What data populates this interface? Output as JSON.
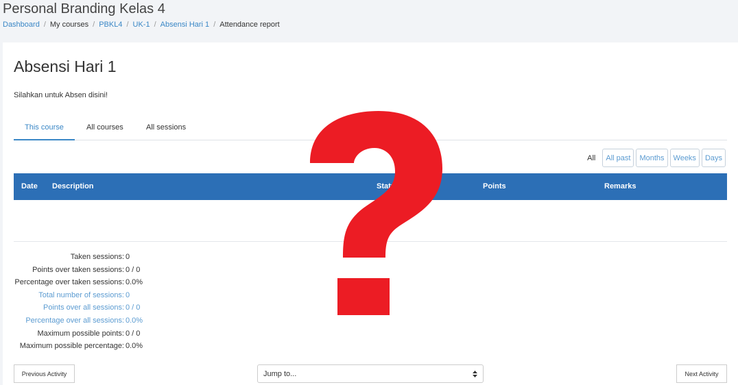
{
  "header": {
    "title": "Personal Branding Kelas 4",
    "breadcrumb": [
      {
        "label": "Dashboard",
        "link": true
      },
      {
        "label": "My courses",
        "link": false
      },
      {
        "label": "PBKL4",
        "link": true
      },
      {
        "label": "UK-1",
        "link": true
      },
      {
        "label": "Absensi Hari 1",
        "link": true
      },
      {
        "label": "Attendance report",
        "link": false
      }
    ]
  },
  "main": {
    "title": "Absensi Hari 1",
    "intro": "Silahkan untuk Absen disini!",
    "tabs": [
      {
        "label": "This course",
        "active": true
      },
      {
        "label": "All courses",
        "active": false
      },
      {
        "label": "All sessions",
        "active": false
      }
    ],
    "filter": {
      "label": "All",
      "buttons": [
        "All past",
        "Months",
        "Weeks",
        "Days"
      ]
    },
    "table": {
      "columns": [
        "Date",
        "Description",
        "Status",
        "Points",
        "Remarks"
      ]
    },
    "summary": [
      {
        "label": "Taken sessions:",
        "value": "0"
      },
      {
        "label": "Points over taken sessions:",
        "value": "0 / 0"
      },
      {
        "label": "Percentage over taken sessions:",
        "value": "0.0%"
      },
      {
        "label": "Total number of sessions:",
        "value": "0"
      },
      {
        "label": "Points over all sessions:",
        "value": "0 / 0"
      },
      {
        "label": "Percentage over all sessions:",
        "value": "0.0%"
      },
      {
        "label": "Maximum possible points:",
        "value": "0 / 0"
      },
      {
        "label": "Maximum possible percentage:",
        "value": "0.0%"
      }
    ]
  },
  "footer": {
    "prev_label": "Previous Activity",
    "jump_label": "Jump to...",
    "next_label": "Next Activity"
  },
  "colors": {
    "accent": "#3a87c6",
    "table_header": "#2c6fb6",
    "overlay_question_mark": "#ec1c24"
  },
  "overlay": {
    "icon": "question-mark-icon"
  }
}
